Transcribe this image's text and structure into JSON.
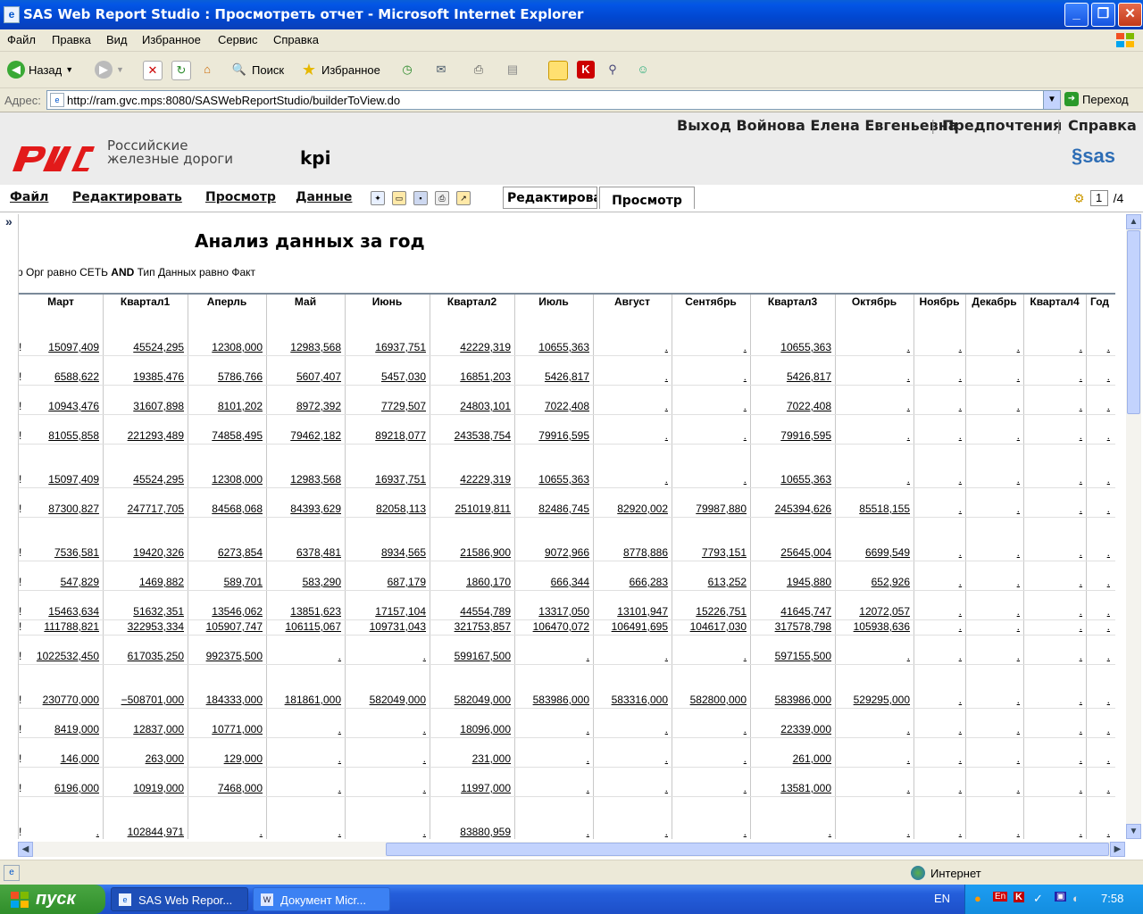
{
  "window": {
    "title": "SAS Web Report Studio : Просмотреть отчет - Microsoft Internet Explorer",
    "app_icon": "ie-document-icon"
  },
  "menu": [
    "Файл",
    "Правка",
    "Вид",
    "Избранное",
    "Сервис",
    "Справка"
  ],
  "toolbar": {
    "back": "Назад",
    "search": "Поиск",
    "favorites": "Избранное"
  },
  "address": {
    "label": "Адрес:",
    "url": "http://ram.gvc.mps:8080/SASWebReportStudio/builderToView.do",
    "go": "Переход"
  },
  "sas_header": {
    "logout": "Выход Войнова Елена Евгеньевна",
    "preferences": "Предпочтения",
    "help": "Справка",
    "org_name_line1": "Российские",
    "org_name_line2": "железные дороги",
    "report_name": "kpi",
    "brand": "sas"
  },
  "sas_menu": {
    "file": "Файл",
    "edit": "Редактировать",
    "view": "Просмотр",
    "data": "Данные",
    "tab_edit": "Редактироват",
    "tab_view": "Просмотр",
    "page_current": "1",
    "page_total": "/4"
  },
  "report": {
    "title": "Анализ данных за год",
    "filter_a": "р Орг равно СЕТЬ ",
    "filter_and": "AND",
    "filter_b": " Тип Данных равно Факт"
  },
  "table": {
    "columns": [
      "Март",
      "Квартал1",
      "Аперль",
      "Май",
      "Июнь",
      "Квартал2",
      "Июль",
      "Август",
      "Сентябрь",
      "Квартал3",
      "Октябрь",
      "Ноябрь",
      "Декабрь",
      "Квартал4",
      "Год"
    ],
    "rows": [
      [
        "15097,409",
        "45524,295",
        "12308,000",
        "12983,568",
        "16937,751",
        "42229,319",
        "10655,363",
        ".",
        ".",
        "10655,363",
        ".",
        ".",
        ".",
        ".",
        "."
      ],
      [
        "6588,622",
        "19385,476",
        "5786,766",
        "5607,407",
        "5457,030",
        "16851,203",
        "5426,817",
        ".",
        ".",
        "5426,817",
        ".",
        ".",
        ".",
        ".",
        "."
      ],
      [
        "10943,476",
        "31607,898",
        "8101,202",
        "8972,392",
        "7729,507",
        "24803,101",
        "7022,408",
        ".",
        ".",
        "7022,408",
        ".",
        ".",
        ".",
        ".",
        "."
      ],
      [
        "81055,858",
        "221293,489",
        "74858,495",
        "79462,182",
        "89218,077",
        "243538,754",
        "79916,595",
        ".",
        ".",
        "79916,595",
        ".",
        ".",
        ".",
        ".",
        "."
      ],
      [
        "15097,409",
        "45524,295",
        "12308,000",
        "12983,568",
        "16937,751",
        "42229,319",
        "10655,363",
        ".",
        ".",
        "10655,363",
        ".",
        ".",
        ".",
        ".",
        "."
      ],
      [
        "87300,827",
        "247717,705",
        "84568,068",
        "84393,629",
        "82058,113",
        "251019,811",
        "82486,745",
        "82920,002",
        "79987,880",
        "245394,626",
        "85518,155",
        ".",
        ".",
        ".",
        "."
      ],
      [
        "7536,581",
        "19420,326",
        "6273,854",
        "6378,481",
        "8934,565",
        "21586,900",
        "9072,966",
        "8778,886",
        "7793,151",
        "25645,004",
        "6699,549",
        ".",
        ".",
        ".",
        "."
      ],
      [
        "547,829",
        "1469,882",
        "589,701",
        "583,290",
        "687,179",
        "1860,170",
        "666,344",
        "666,283",
        "613,252",
        "1945,880",
        "652,926",
        ".",
        ".",
        ".",
        "."
      ],
      [
        "15463,634",
        "51632,351",
        "13546,062",
        "13851,623",
        "17157,104",
        "44554,789",
        "13317,050",
        "13101,947",
        "15226,751",
        "41645,747",
        "12072,057",
        ".",
        ".",
        ".",
        "."
      ],
      [
        "111788,821",
        "322953,334",
        "105907,747",
        "106115,067",
        "109731,043",
        "321753,857",
        "106470,072",
        "106491,695",
        "104617,030",
        "317578,798",
        "105938,636",
        ".",
        ".",
        ".",
        "."
      ],
      [
        "1022532,450",
        "617035,250",
        "992375,500",
        ".",
        ".",
        "599167,500",
        ".",
        ".",
        ".",
        "597155,500",
        ".",
        ".",
        ".",
        ".",
        "."
      ],
      [
        "230770,000",
        "−508701,000",
        "184333,000",
        "181861,000",
        "582049,000",
        "582049,000",
        "583986,000",
        "583316,000",
        "582800,000",
        "583986,000",
        "529295,000",
        ".",
        ".",
        ".",
        "."
      ],
      [
        "8419,000",
        "12837,000",
        "10771,000",
        ".",
        ".",
        "18096,000",
        ".",
        ".",
        ".",
        "22339,000",
        ".",
        ".",
        ".",
        ".",
        "."
      ],
      [
        "146,000",
        "263,000",
        "129,000",
        ".",
        ".",
        "231,000",
        ".",
        ".",
        ".",
        "261,000",
        ".",
        ".",
        ".",
        ".",
        "."
      ],
      [
        "6196,000",
        "10919,000",
        "7468,000",
        ".",
        ".",
        "11997,000",
        ".",
        ".",
        ".",
        "13581,000",
        ".",
        ".",
        ".",
        ".",
        "."
      ],
      [
        ".",
        "102844,971",
        ".",
        ".",
        ".",
        "83880,959",
        ".",
        ".",
        ".",
        ".",
        ".",
        ".",
        ".",
        ".",
        "."
      ]
    ]
  },
  "status": {
    "zone": "Интернет"
  },
  "taskbar": {
    "start": "пуск",
    "task1": "SAS Web Repor...",
    "task2": "Документ Micr...",
    "lang": "EN",
    "clock": "7:58"
  }
}
